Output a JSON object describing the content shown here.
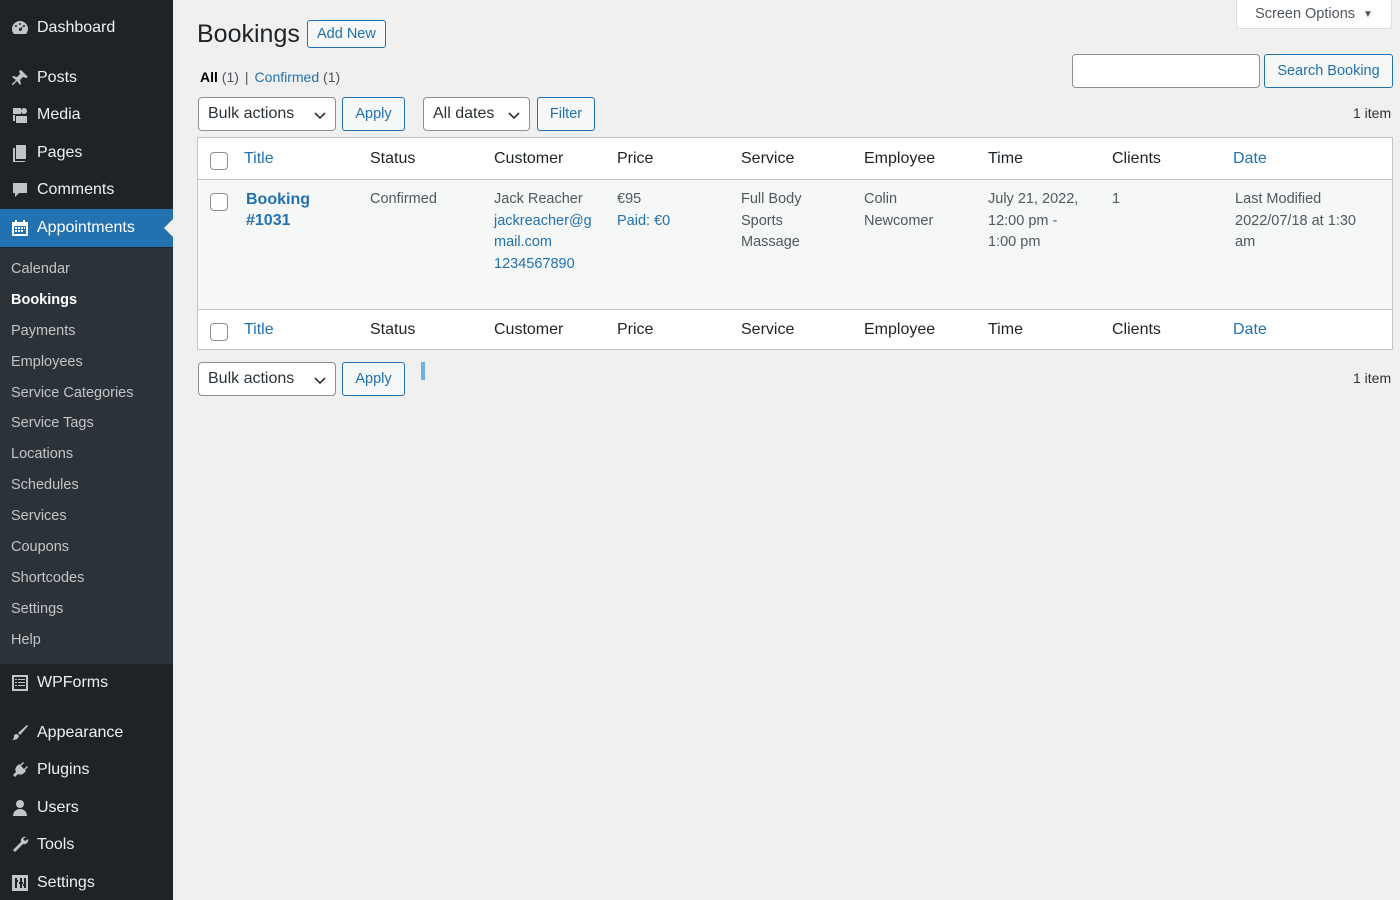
{
  "sidebar": {
    "top_items": [
      {
        "label": "Dashboard",
        "icon": "dashboard-icon"
      },
      {
        "label": "Posts",
        "icon": "pin-icon"
      },
      {
        "label": "Media",
        "icon": "media-icon"
      },
      {
        "label": "Pages",
        "icon": "pages-icon"
      },
      {
        "label": "Comments",
        "icon": "comments-icon"
      },
      {
        "label": "Appointments",
        "icon": "calendar-icon"
      }
    ],
    "submenu": [
      "Calendar",
      "Bookings",
      "Payments",
      "Employees",
      "Service Categories",
      "Service Tags",
      "Locations",
      "Schedules",
      "Services",
      "Coupons",
      "Shortcodes",
      "Settings",
      "Help"
    ],
    "bottom_items": [
      {
        "label": "WPForms",
        "icon": "forms-icon"
      },
      {
        "label": "Appearance",
        "icon": "brush-icon"
      },
      {
        "label": "Plugins",
        "icon": "plugin-icon"
      },
      {
        "label": "Users",
        "icon": "users-icon"
      },
      {
        "label": "Tools",
        "icon": "wrench-icon"
      },
      {
        "label": "Settings",
        "icon": "settings-icon"
      }
    ]
  },
  "header": {
    "title": "Bookings",
    "add_new": "Add New",
    "screen_options": "Screen Options"
  },
  "filters": {
    "all_label": "All",
    "all_count": "(1)",
    "separator": "|",
    "confirmed_label": "Confirmed",
    "confirmed_count": "(1)"
  },
  "search": {
    "value": "",
    "button": "Search Booking"
  },
  "toolbar": {
    "bulk_actions": "Bulk actions",
    "apply": "Apply",
    "all_dates": "All dates",
    "filter": "Filter",
    "items_count": "1 item"
  },
  "table": {
    "columns": [
      "Title",
      "Status",
      "Customer",
      "Price",
      "Service",
      "Employee",
      "Time",
      "Clients",
      "Date"
    ],
    "rows": [
      {
        "title_line1": "Booking",
        "title_line2": "#1031",
        "status": "Confirmed",
        "customer_name": "Jack Reacher",
        "customer_email_line1": "jackreacher@g",
        "customer_email_line2": "mail.com",
        "customer_phone": "1234567890",
        "price": "€95",
        "paid": "Paid: €0",
        "service_line1": "Full Body",
        "service_line2": "Sports",
        "service_line3": "Massage",
        "employee_line1": "Colin",
        "employee_line2": "Newcomer",
        "time_line1": "July 21, 2022,",
        "time_line2": "12:00 pm -",
        "time_line3": "1:00 pm",
        "clients": "1",
        "date_line1": "Last Modified",
        "date_line2": "2022/07/18 at 1:30",
        "date_line3": "am"
      }
    ]
  },
  "colors": {
    "sidebar_bg": "#1d2327",
    "submenu_bg": "#2c3338",
    "accent": "#2271b1",
    "page_bg": "#f0f0f1"
  }
}
